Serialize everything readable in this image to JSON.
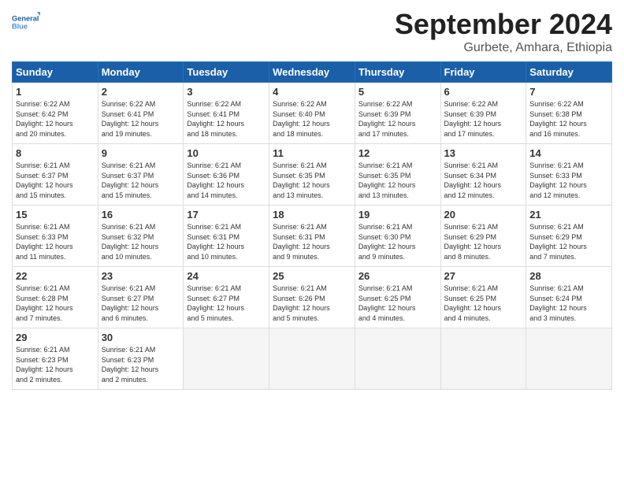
{
  "logo": {
    "line1": "General",
    "line2": "Blue"
  },
  "title": "September 2024",
  "subtitle": "Gurbete, Amhara, Ethiopia",
  "weekdays": [
    "Sunday",
    "Monday",
    "Tuesday",
    "Wednesday",
    "Thursday",
    "Friday",
    "Saturday"
  ],
  "weeks": [
    [
      {
        "day": "1",
        "info": "Sunrise: 6:22 AM\nSunset: 6:42 PM\nDaylight: 12 hours\nand 20 minutes."
      },
      {
        "day": "2",
        "info": "Sunrise: 6:22 AM\nSunset: 6:41 PM\nDaylight: 12 hours\nand 19 minutes."
      },
      {
        "day": "3",
        "info": "Sunrise: 6:22 AM\nSunset: 6:41 PM\nDaylight: 12 hours\nand 18 minutes."
      },
      {
        "day": "4",
        "info": "Sunrise: 6:22 AM\nSunset: 6:40 PM\nDaylight: 12 hours\nand 18 minutes."
      },
      {
        "day": "5",
        "info": "Sunrise: 6:22 AM\nSunset: 6:39 PM\nDaylight: 12 hours\nand 17 minutes."
      },
      {
        "day": "6",
        "info": "Sunrise: 6:22 AM\nSunset: 6:39 PM\nDaylight: 12 hours\nand 17 minutes."
      },
      {
        "day": "7",
        "info": "Sunrise: 6:22 AM\nSunset: 6:38 PM\nDaylight: 12 hours\nand 16 minutes."
      }
    ],
    [
      {
        "day": "8",
        "info": "Sunrise: 6:21 AM\nSunset: 6:37 PM\nDaylight: 12 hours\nand 15 minutes."
      },
      {
        "day": "9",
        "info": "Sunrise: 6:21 AM\nSunset: 6:37 PM\nDaylight: 12 hours\nand 15 minutes."
      },
      {
        "day": "10",
        "info": "Sunrise: 6:21 AM\nSunset: 6:36 PM\nDaylight: 12 hours\nand 14 minutes."
      },
      {
        "day": "11",
        "info": "Sunrise: 6:21 AM\nSunset: 6:35 PM\nDaylight: 12 hours\nand 13 minutes."
      },
      {
        "day": "12",
        "info": "Sunrise: 6:21 AM\nSunset: 6:35 PM\nDaylight: 12 hours\nand 13 minutes."
      },
      {
        "day": "13",
        "info": "Sunrise: 6:21 AM\nSunset: 6:34 PM\nDaylight: 12 hours\nand 12 minutes."
      },
      {
        "day": "14",
        "info": "Sunrise: 6:21 AM\nSunset: 6:33 PM\nDaylight: 12 hours\nand 12 minutes."
      }
    ],
    [
      {
        "day": "15",
        "info": "Sunrise: 6:21 AM\nSunset: 6:33 PM\nDaylight: 12 hours\nand 11 minutes."
      },
      {
        "day": "16",
        "info": "Sunrise: 6:21 AM\nSunset: 6:32 PM\nDaylight: 12 hours\nand 10 minutes."
      },
      {
        "day": "17",
        "info": "Sunrise: 6:21 AM\nSunset: 6:31 PM\nDaylight: 12 hours\nand 10 minutes."
      },
      {
        "day": "18",
        "info": "Sunrise: 6:21 AM\nSunset: 6:31 PM\nDaylight: 12 hours\nand 9 minutes."
      },
      {
        "day": "19",
        "info": "Sunrise: 6:21 AM\nSunset: 6:30 PM\nDaylight: 12 hours\nand 9 minutes."
      },
      {
        "day": "20",
        "info": "Sunrise: 6:21 AM\nSunset: 6:29 PM\nDaylight: 12 hours\nand 8 minutes."
      },
      {
        "day": "21",
        "info": "Sunrise: 6:21 AM\nSunset: 6:29 PM\nDaylight: 12 hours\nand 7 minutes."
      }
    ],
    [
      {
        "day": "22",
        "info": "Sunrise: 6:21 AM\nSunset: 6:28 PM\nDaylight: 12 hours\nand 7 minutes."
      },
      {
        "day": "23",
        "info": "Sunrise: 6:21 AM\nSunset: 6:27 PM\nDaylight: 12 hours\nand 6 minutes."
      },
      {
        "day": "24",
        "info": "Sunrise: 6:21 AM\nSunset: 6:27 PM\nDaylight: 12 hours\nand 5 minutes."
      },
      {
        "day": "25",
        "info": "Sunrise: 6:21 AM\nSunset: 6:26 PM\nDaylight: 12 hours\nand 5 minutes."
      },
      {
        "day": "26",
        "info": "Sunrise: 6:21 AM\nSunset: 6:25 PM\nDaylight: 12 hours\nand 4 minutes."
      },
      {
        "day": "27",
        "info": "Sunrise: 6:21 AM\nSunset: 6:25 PM\nDaylight: 12 hours\nand 4 minutes."
      },
      {
        "day": "28",
        "info": "Sunrise: 6:21 AM\nSunset: 6:24 PM\nDaylight: 12 hours\nand 3 minutes."
      }
    ],
    [
      {
        "day": "29",
        "info": "Sunrise: 6:21 AM\nSunset: 6:23 PM\nDaylight: 12 hours\nand 2 minutes."
      },
      {
        "day": "30",
        "info": "Sunrise: 6:21 AM\nSunset: 6:23 PM\nDaylight: 12 hours\nand 2 minutes."
      },
      {
        "day": "",
        "info": ""
      },
      {
        "day": "",
        "info": ""
      },
      {
        "day": "",
        "info": ""
      },
      {
        "day": "",
        "info": ""
      },
      {
        "day": "",
        "info": ""
      }
    ]
  ]
}
